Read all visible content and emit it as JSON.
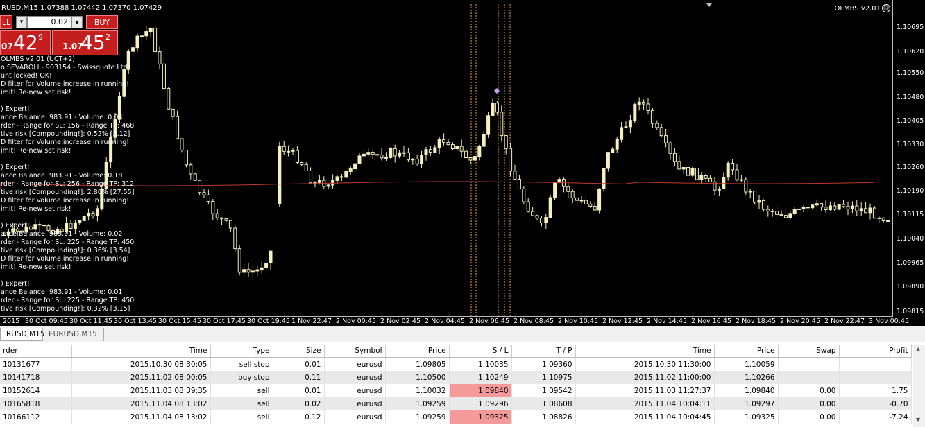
{
  "chart": {
    "title": "RUSD,M15  1.07388 1.07442 1.07370 1.07429",
    "expert_badge": "OLMBS v2.01",
    "price_ticks": [
      "1.10695",
      "1.10620",
      "1.10550",
      "1.10480",
      "1.10405",
      "1.10330",
      "1.10260",
      "1.10190",
      "1.10115",
      "1.10040",
      "1.09965",
      "1.09890",
      "1.09815"
    ],
    "time_ticks": [
      "2015",
      "30 Oct 09:45",
      "30 Oct 11:45",
      "30 Oct 13:45",
      "30 Oct 15:45",
      "30 Oct 17:45",
      "30 Oct 19:45",
      "1 Nov 22:47",
      "2 Nov 00:45",
      "2 Nov 02:45",
      "2 Nov 04:45",
      "2 Nov 06:45",
      "2 Nov 08:45",
      "2 Nov 10:45",
      "2 Nov 12:45",
      "2 Nov 14:45",
      "2 Nov 16:45",
      "2 Nov 18:45",
      "2 Nov 20:45",
      "2 Nov 22:47",
      "3 Nov 00:45"
    ],
    "info_lines": [
      "OLMBS v2.01 (UCT+2)",
      "o SEVAROLI - 903154 - Swissquote Ltd",
      "unt locked! OK!",
      "D filter for Volume increase in running!",
      "imit! Re-new set risk!",
      "",
      ") Expert!",
      "ance Balance: 983.91 - Volume: 0.03",
      "rder - Range for SL: 156 - Range TP: 468",
      "tive risk [Compounding!]: 0.52% [5.12]",
      "D filter for Volume increase in running!",
      "imit! Re-new set risk!",
      "",
      ") Expert!",
      "ance Balance: 983.91 - Volume: 0.18",
      "rder - Range for SL: 256 - Range TP: 312",
      "tive risk [Compounding!]: 2.80% [27.55]",
      "D filter for Volume increase in running!",
      "imit! Re-new set risk!",
      "",
      ") Expert!",
      "ance Balance: 983.91 - Volume: 0.02",
      "rder - Range for SL: 225 - Range TP: 450",
      "tive risk [Compounding!]: 0.36% [3.54]",
      "D filter for Volume increase in running!",
      "imit! Re-new set risk!",
      "",
      ") Expert!",
      "ance Balance: 983.91 - Volume: 0.01",
      "rder - Range for SL: 225 - Range TP: 450",
      "tive risk [Compounding!]: 0.32% [3.15]"
    ]
  },
  "one_click": {
    "sell_label": "LL",
    "buy_label": "BUY",
    "lot": "0.02",
    "sell_prefix": "07",
    "sell_big": "42",
    "sell_sup": "9",
    "buy_prefix": "1.07",
    "buy_big": "45",
    "buy_sup": "2"
  },
  "tabs": [
    "RUSD,M15",
    "EURUSD,M15"
  ],
  "table": {
    "headers": [
      "rder",
      "Time",
      "Type",
      "Size",
      "Symbol",
      "Price",
      "S / L",
      "T / P",
      "Time",
      "Price",
      "Swap",
      "Profit"
    ],
    "rows": [
      [
        "10131677",
        "2015.10.30 08:30:05",
        "sell stop",
        "0.01",
        "eurusd",
        "1.09805",
        "1.10035",
        "1.09360",
        "2015.10.30 11:30:00",
        "1.10059",
        "",
        ""
      ],
      [
        "10141718",
        "2015.11.02 08:00:05",
        "buy stop",
        "0.11",
        "eurusd",
        "1.10500",
        "1.10249",
        "1.10975",
        "2015.11.02 11:00:00",
        "1.10266",
        "",
        ""
      ],
      [
        "10152614",
        "2015.11.03 08:39:35",
        "sell",
        "0.01",
        "eurusd",
        "1.10032",
        "1.09840",
        "1.09542",
        "2015.11.03 11:27:37",
        "1.09840",
        "0.00",
        "1.75"
      ],
      [
        "10165818",
        "2015.11.04 08:13:02",
        "sell",
        "0.02",
        "eurusd",
        "1.09259",
        "1.09296",
        "1.08608",
        "2015.11.04 10:04:11",
        "1.09297",
        "0.00",
        "-0.70"
      ],
      [
        "10166112",
        "2015.11.04 08:13:02",
        "sell",
        "0.12",
        "eurusd",
        "1.09259",
        "1.09325",
        "1.08826",
        "2015.11.04 10:04:45",
        "1.09325",
        "0.00",
        "-7.24"
      ]
    ]
  }
}
